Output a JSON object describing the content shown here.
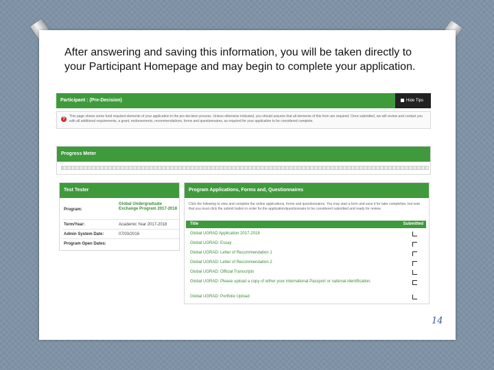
{
  "caption": "After answering and saving this information, you will be taken directly to your Participant Homepage and may begin to complete your application.",
  "header": {
    "title": "Participant : (Pre-Decision)",
    "hide_label": "Hide Tips"
  },
  "alert": {
    "text": "This page shows some fund required elements of your application in the pre-decision process. Unless otherwise indicated, you should assume that all elements of this form are required. Once submitted, we will review and contact you with all additional requirements, a grant, endorsements, recommendations, forms and questionnaires, as required for your application to be considered complete."
  },
  "progress": {
    "title": "Progress Meter"
  },
  "student": {
    "name": "Test Tester",
    "fields": [
      {
        "label": "Program:",
        "value": "Global Undergraduate Exchange Program 2017-2018"
      },
      {
        "label": "Term/Year:",
        "value": "Academic Year 2017-2018"
      },
      {
        "label": "Admin System Date:",
        "value": "07/03/2016"
      },
      {
        "label": "Program Open Dates:",
        "value": ""
      }
    ]
  },
  "applications": {
    "title": "Program Applications, Forms and, Questionnaires",
    "intro": "Click the following to view and complete the online applications, forms and questionnaires. You may start a form and save it for later completion, but note that you must click the submit button in order for the application/questionnaire to be considered submitted and ready for review.",
    "col_title": "Title",
    "col_submitted": "Submitted",
    "items": [
      {
        "title": "Global UGRAD Application 2017-2018"
      },
      {
        "title": "Global UGRAD: Essay"
      },
      {
        "title": "Global UGRAD: Letter of Recommendation 1"
      },
      {
        "title": "Global UGRAD: Letter of Recommendation 2"
      },
      {
        "title": "Global UGRAD: Official Transcripts"
      },
      {
        "title": "Global UGRAD: Please upload a copy of either your international Passport or national identification."
      },
      {
        "title": "Global UGRAD: Portfolio Upload"
      }
    ]
  },
  "page_number": "14"
}
